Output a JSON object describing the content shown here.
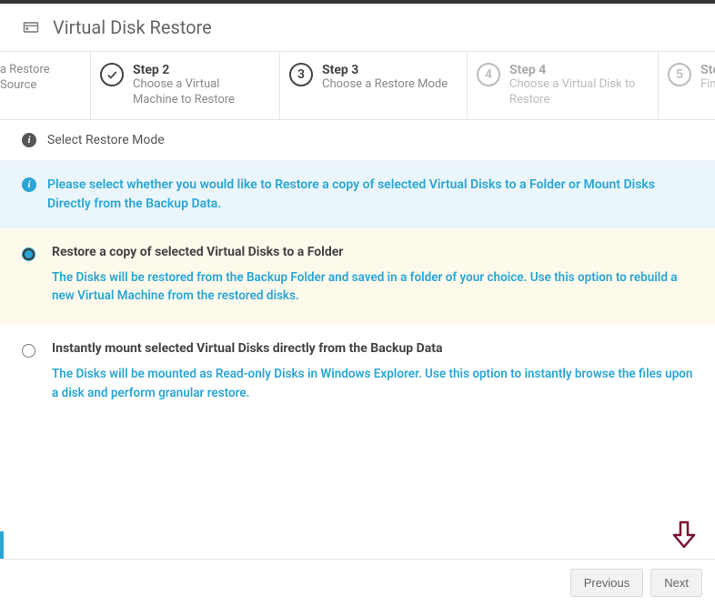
{
  "header": {
    "title": "Virtual Disk Restore"
  },
  "steps": [
    {
      "title": "",
      "sub": "a Restore Source"
    },
    {
      "title": "Step 2",
      "sub": "Choose a Virtual Machine to Restore"
    },
    {
      "title": "Step 3",
      "sub": "Choose a Restore Mode",
      "num": "3"
    },
    {
      "title": "Step 4",
      "sub": "Choose a Virtual Disk to Restore",
      "num": "4"
    },
    {
      "title": "Ste",
      "sub": "Fini",
      "num": "5"
    }
  ],
  "section": {
    "heading": "Select Restore Mode"
  },
  "notice": "Please select whether you would like to Restore a copy of selected Virtual Disks to a Folder or Mount Disks Directly from the Backup Data.",
  "options": [
    {
      "title": "Restore a copy of selected Virtual Disks to a Folder",
      "desc": "The Disks will be restored from the Backup Folder and saved in a folder of your choice. Use this option to rebuild a new Virtual Machine from the restored disks.",
      "selected": true
    },
    {
      "title": "Instantly mount selected Virtual Disks directly from the Backup Data",
      "desc": "The Disks will be mounted as Read-only Disks in Windows Explorer. Use this option to instantly browse the files upon a disk and perform granular restore.",
      "selected": false
    }
  ],
  "footer": {
    "previous": "Previous",
    "next": "Next"
  }
}
